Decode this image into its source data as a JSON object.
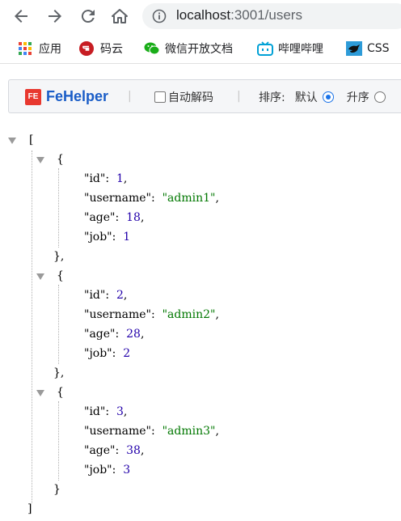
{
  "browser": {
    "url_host": "localhost",
    "url_path": ":3001/users"
  },
  "bookmarks": [
    {
      "label": "应用",
      "icon": "apps-grid-icon"
    },
    {
      "label": "码云",
      "icon": "gitee-icon"
    },
    {
      "label": "微信开放文档",
      "icon": "wechat-icon"
    },
    {
      "label": "哔哩哔哩",
      "icon": "bilibili-icon"
    },
    {
      "label": "CSS",
      "icon": "css-bird-icon"
    }
  ],
  "fehelper": {
    "brand": "FeHelper",
    "badge": "FE",
    "sep": "|",
    "auto_decode": "自动解码",
    "sort_label": "排序:",
    "sort_default": "默认",
    "sort_asc": "升序"
  },
  "json": {
    "open_bracket": "[",
    "close_bracket": "]",
    "open_brace": "{",
    "close_brace": "}",
    "close_brace_comma": "},",
    "keys": {
      "id": "\"id\":",
      "username": "\"username\":",
      "age": "\"age\":",
      "job": "\"job\":"
    },
    "records": [
      {
        "id": "1",
        "username": "\"admin1\"",
        "age": "18",
        "job": "1"
      },
      {
        "id": "2",
        "username": "\"admin2\"",
        "age": "28",
        "job": "2"
      },
      {
        "id": "3",
        "username": "\"admin3\"",
        "age": "38",
        "job": "3"
      }
    ]
  },
  "colors": {
    "accent": "#1a73e8",
    "number": "#2200aa",
    "string": "#007700"
  }
}
